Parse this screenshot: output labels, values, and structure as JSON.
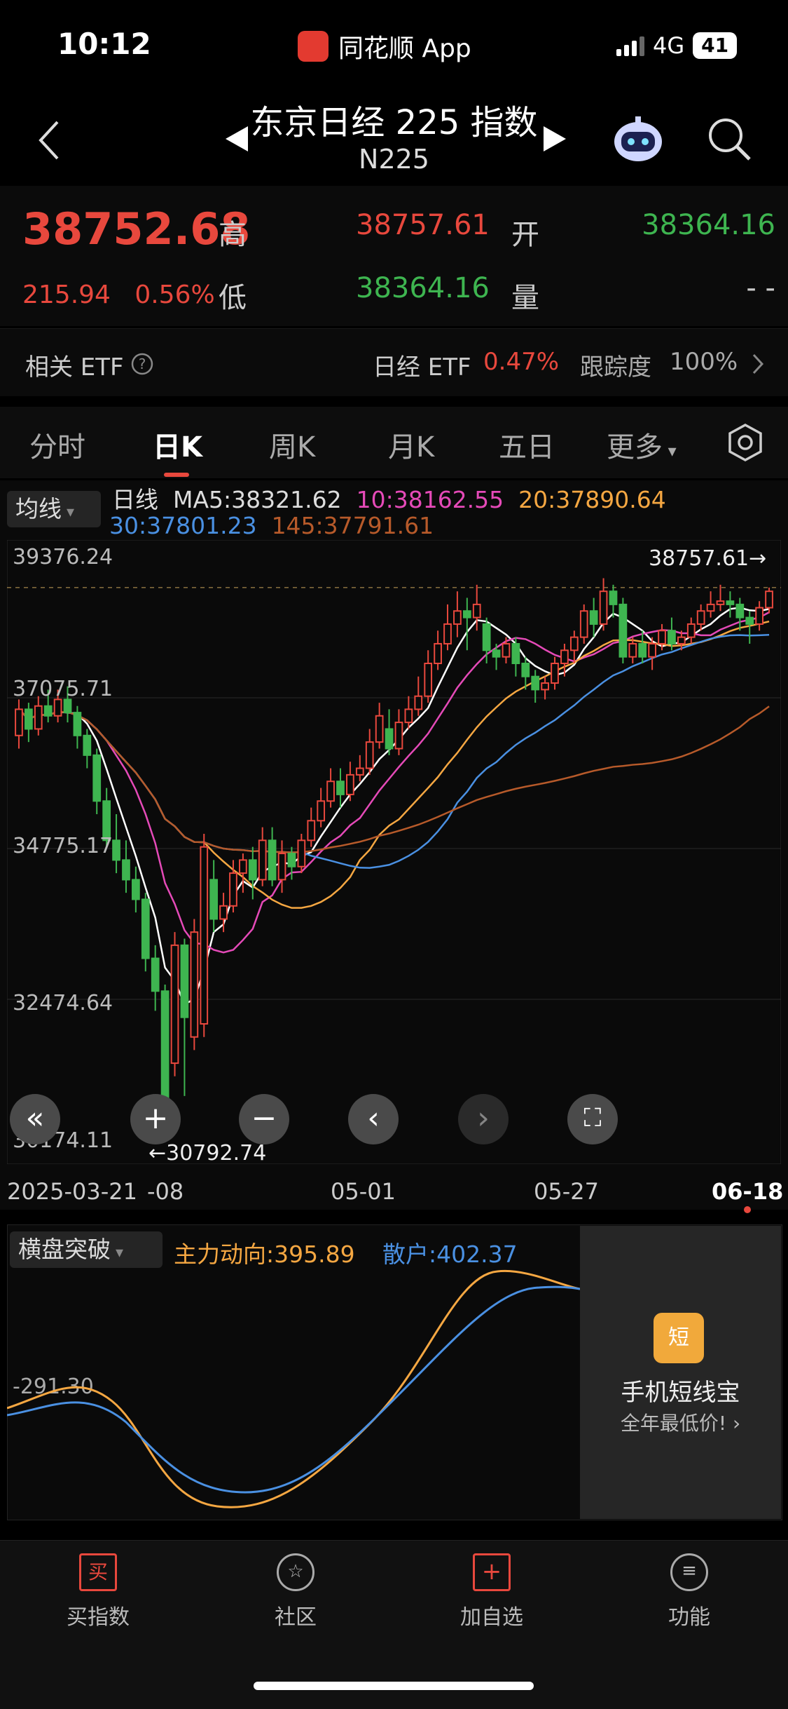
{
  "status_bar": {
    "time": "10:12",
    "app": "同花顺 App",
    "network": "4G",
    "battery": "41"
  },
  "header": {
    "title": "东京日经 225 指数",
    "subtitle": "N225"
  },
  "quote": {
    "price": "38752.68",
    "change": "215.94",
    "change_pct": "0.56%",
    "high_label": "高",
    "high": "38757.61",
    "open_label": "开",
    "open": "38364.16",
    "low_label": "低",
    "low": "38364.16",
    "vol_label": "量",
    "vol": "- -"
  },
  "etf": {
    "label": "相关 ETF",
    "name": "日经 ETF",
    "pct": "0.47%",
    "track_label": "跟踪度",
    "track": "100%"
  },
  "tabs": [
    "分时",
    "日K",
    "周K",
    "月K",
    "五日",
    "更多"
  ],
  "active_tab": "日K",
  "ma": {
    "dropdown": "均线",
    "type": "日线",
    "ma5": "MA5:38321.62",
    "ma10": "10:38162.55",
    "ma20": "20:37890.64",
    "ma30": "30:37801.23",
    "ma145": "145:37791.61"
  },
  "chart": {
    "y_labels": [
      "39376.24",
      "37075.71",
      "34775.17",
      "32474.64",
      "30174.11"
    ],
    "high_mark": "38757.61→",
    "low_mark": "←30792.74",
    "x_labels": [
      "2025-03-21",
      "-08",
      "05-01",
      "05-27",
      "06-18"
    ],
    "colors": {
      "ma5": "#ffffff",
      "ma10": "#e54ab8",
      "ma20": "#f5a742",
      "ma30": "#4a90e2",
      "ma145": "#b75a2a",
      "up": "#e8483d",
      "down": "#3eb550"
    }
  },
  "chart_data": {
    "type": "candlestick",
    "ylim": [
      30174.11,
      39376.24
    ],
    "candles": [
      {
        "o": 36500,
        "c": 36900,
        "h": 37050,
        "l": 36300
      },
      {
        "o": 36900,
        "c": 36600,
        "h": 37000,
        "l": 36400
      },
      {
        "o": 36600,
        "c": 36950,
        "h": 37100,
        "l": 36500
      },
      {
        "o": 36950,
        "c": 36800,
        "h": 37200,
        "l": 36700
      },
      {
        "o": 36800,
        "c": 37050,
        "h": 37200,
        "l": 36700
      },
      {
        "o": 37050,
        "c": 36850,
        "h": 37250,
        "l": 36700
      },
      {
        "o": 36850,
        "c": 36500,
        "h": 36950,
        "l": 36300
      },
      {
        "o": 36500,
        "c": 36200,
        "h": 36600,
        "l": 36000
      },
      {
        "o": 36200,
        "c": 35500,
        "h": 36300,
        "l": 35300
      },
      {
        "o": 35500,
        "c": 34900,
        "h": 35700,
        "l": 34800
      },
      {
        "o": 34900,
        "c": 34600,
        "h": 35300,
        "l": 34400
      },
      {
        "o": 34600,
        "c": 34300,
        "h": 34900,
        "l": 34100
      },
      {
        "o": 34300,
        "c": 34000,
        "h": 34500,
        "l": 33800
      },
      {
        "o": 34000,
        "c": 33100,
        "h": 34100,
        "l": 32900
      },
      {
        "o": 33100,
        "c": 32600,
        "h": 33300,
        "l": 32300
      },
      {
        "o": 32600,
        "c": 30792.74,
        "h": 32700,
        "l": 30792.74
      },
      {
        "o": 31500,
        "c": 33300,
        "h": 33500,
        "l": 31300
      },
      {
        "o": 33300,
        "c": 32200,
        "h": 33400,
        "l": 31000
      },
      {
        "o": 31900,
        "c": 33500,
        "h": 33700,
        "l": 31700
      },
      {
        "o": 32100,
        "c": 34800,
        "h": 35000,
        "l": 31900
      },
      {
        "o": 34300,
        "c": 33700,
        "h": 34600,
        "l": 33500
      },
      {
        "o": 33700,
        "c": 33900,
        "h": 34100,
        "l": 33500
      },
      {
        "o": 33900,
        "c": 34400,
        "h": 34600,
        "l": 33800
      },
      {
        "o": 34400,
        "c": 34600,
        "h": 34700,
        "l": 34100
      },
      {
        "o": 34600,
        "c": 34300,
        "h": 34800,
        "l": 34000
      },
      {
        "o": 34300,
        "c": 34900,
        "h": 35100,
        "l": 34200
      },
      {
        "o": 34900,
        "c": 34300,
        "h": 35100,
        "l": 34200
      },
      {
        "o": 34300,
        "c": 34700,
        "h": 34900,
        "l": 34100
      },
      {
        "o": 34700,
        "c": 34500,
        "h": 34800,
        "l": 34300
      },
      {
        "o": 34500,
        "c": 34900,
        "h": 35000,
        "l": 34400
      },
      {
        "o": 34900,
        "c": 35200,
        "h": 35400,
        "l": 34800
      },
      {
        "o": 35200,
        "c": 35500,
        "h": 35700,
        "l": 35100
      },
      {
        "o": 35500,
        "c": 35800,
        "h": 36000,
        "l": 35400
      },
      {
        "o": 35800,
        "c": 35600,
        "h": 36000,
        "l": 35400
      },
      {
        "o": 35600,
        "c": 35900,
        "h": 36100,
        "l": 35500
      },
      {
        "o": 35900,
        "c": 36000,
        "h": 36200,
        "l": 35800
      },
      {
        "o": 36000,
        "c": 36400,
        "h": 36600,
        "l": 35900
      },
      {
        "o": 36400,
        "c": 36800,
        "h": 37000,
        "l": 36300
      },
      {
        "o": 36600,
        "c": 36300,
        "h": 36900,
        "l": 36200
      },
      {
        "o": 36300,
        "c": 36700,
        "h": 36900,
        "l": 36200
      },
      {
        "o": 36700,
        "c": 36900,
        "h": 37100,
        "l": 36600
      },
      {
        "o": 36900,
        "c": 37100,
        "h": 37400,
        "l": 36800
      },
      {
        "o": 37100,
        "c": 37600,
        "h": 37800,
        "l": 37000
      },
      {
        "o": 37600,
        "c": 37900,
        "h": 38100,
        "l": 37500
      },
      {
        "o": 37900,
        "c": 38200,
        "h": 38500,
        "l": 37800
      },
      {
        "o": 38200,
        "c": 38400,
        "h": 38700,
        "l": 38000
      },
      {
        "o": 38400,
        "c": 38300,
        "h": 38600,
        "l": 37800
      },
      {
        "o": 38300,
        "c": 38500,
        "h": 38800,
        "l": 38100
      },
      {
        "o": 38200,
        "c": 37800,
        "h": 38300,
        "l": 37600
      },
      {
        "o": 37800,
        "c": 37700,
        "h": 37900,
        "l": 37500
      },
      {
        "o": 37700,
        "c": 37900,
        "h": 38000,
        "l": 37600
      },
      {
        "o": 37900,
        "c": 37600,
        "h": 38000,
        "l": 37400
      },
      {
        "o": 37600,
        "c": 37400,
        "h": 37700,
        "l": 37200
      },
      {
        "o": 37400,
        "c": 37200,
        "h": 37500,
        "l": 37000
      },
      {
        "o": 37200,
        "c": 37300,
        "h": 37400,
        "l": 37050
      },
      {
        "o": 37300,
        "c": 37600,
        "h": 37700,
        "l": 37200
      },
      {
        "o": 37600,
        "c": 37800,
        "h": 37900,
        "l": 37400
      },
      {
        "o": 37800,
        "c": 38000,
        "h": 38100,
        "l": 37600
      },
      {
        "o": 38000,
        "c": 38400,
        "h": 38500,
        "l": 37900
      },
      {
        "o": 38400,
        "c": 38200,
        "h": 38600,
        "l": 38000
      },
      {
        "o": 38200,
        "c": 38700,
        "h": 38900,
        "l": 38100
      },
      {
        "o": 38700,
        "c": 38500,
        "h": 38800,
        "l": 38300
      },
      {
        "o": 38500,
        "c": 37700,
        "h": 38600,
        "l": 37600
      },
      {
        "o": 37700,
        "c": 37900,
        "h": 38000,
        "l": 37600
      },
      {
        "o": 37900,
        "c": 37700,
        "h": 38100,
        "l": 37600
      },
      {
        "o": 37700,
        "c": 37900,
        "h": 38000,
        "l": 37500
      },
      {
        "o": 37900,
        "c": 38100,
        "h": 38200,
        "l": 37800
      },
      {
        "o": 38100,
        "c": 37900,
        "h": 38300,
        "l": 37800
      },
      {
        "o": 37900,
        "c": 38000,
        "h": 38100,
        "l": 37800
      },
      {
        "o": 38000,
        "c": 38200,
        "h": 38300,
        "l": 37900
      },
      {
        "o": 38200,
        "c": 38400,
        "h": 38500,
        "l": 38100
      },
      {
        "o": 38400,
        "c": 38500,
        "h": 38700,
        "l": 38300
      },
      {
        "o": 38500,
        "c": 38550,
        "h": 38800,
        "l": 38400
      },
      {
        "o": 38550,
        "c": 38500,
        "h": 38700,
        "l": 38300
      },
      {
        "o": 38500,
        "c": 38300,
        "h": 38600,
        "l": 38100
      },
      {
        "o": 38300,
        "c": 38200,
        "h": 38400,
        "l": 37900
      },
      {
        "o": 38200,
        "c": 38450,
        "h": 38550,
        "l": 38100
      },
      {
        "o": 38450,
        "c": 38700,
        "h": 38757.61,
        "l": 38364.16
      }
    ]
  },
  "indicator": {
    "dropdown": "横盘突破",
    "main": "主力动向:395.89",
    "retail": "散户:402.37",
    "level": "-291.30"
  },
  "ad": {
    "icon": "短",
    "title": "手机短线宝",
    "subtitle": "全年最低价!"
  },
  "nav": [
    {
      "label": "买指数",
      "icon": "buy-icon"
    },
    {
      "label": "社区",
      "icon": "community-icon"
    },
    {
      "label": "加自选",
      "icon": "add-watchlist-icon"
    },
    {
      "label": "功能",
      "icon": "menu-icon"
    }
  ]
}
